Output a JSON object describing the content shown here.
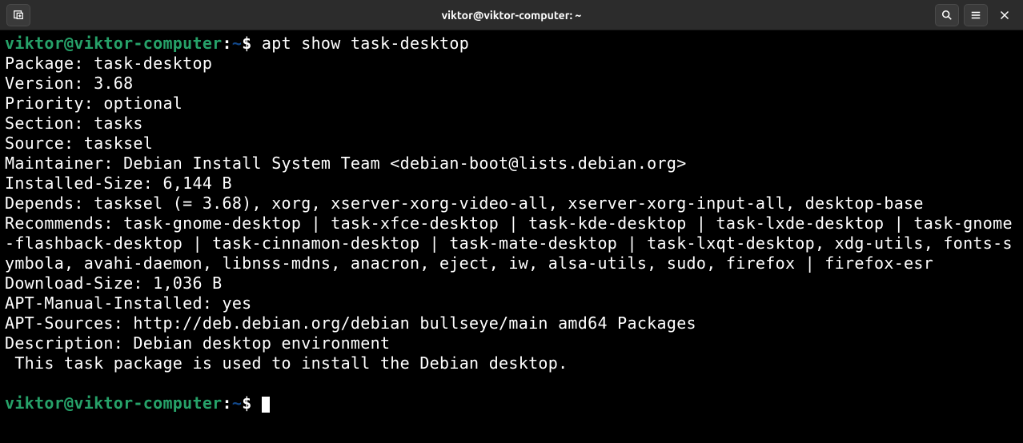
{
  "window": {
    "title": "viktor@viktor-computer: ~"
  },
  "prompt": {
    "user_host": "viktor@viktor-computer",
    "separator": ":",
    "path": "~",
    "symbol": "$"
  },
  "command": "apt show task-desktop",
  "output": {
    "package": "Package: task-desktop",
    "version": "Version: 3.68",
    "priority": "Priority: optional",
    "section": "Section: tasks",
    "source": "Source: tasksel",
    "maintainer": "Maintainer: Debian Install System Team <debian-boot@lists.debian.org>",
    "installed_size": "Installed-Size: 6,144 B",
    "depends": "Depends: tasksel (= 3.68), xorg, xserver-xorg-video-all, xserver-xorg-input-all, desktop-base",
    "recommends": "Recommends: task-gnome-desktop | task-xfce-desktop | task-kde-desktop | task-lxde-desktop | task-gnome-flashback-desktop | task-cinnamon-desktop | task-mate-desktop | task-lxqt-desktop, xdg-utils, fonts-symbola, avahi-daemon, libnss-mdns, anacron, eject, iw, alsa-utils, sudo, firefox | firefox-esr",
    "download_size": "Download-Size: 1,036 B",
    "apt_manual_installed": "APT-Manual-Installed: yes",
    "apt_sources": "APT-Sources: http://deb.debian.org/debian bullseye/main amd64 Packages",
    "description": "Description: Debian desktop environment",
    "description_long": " This task package is used to install the Debian desktop."
  }
}
